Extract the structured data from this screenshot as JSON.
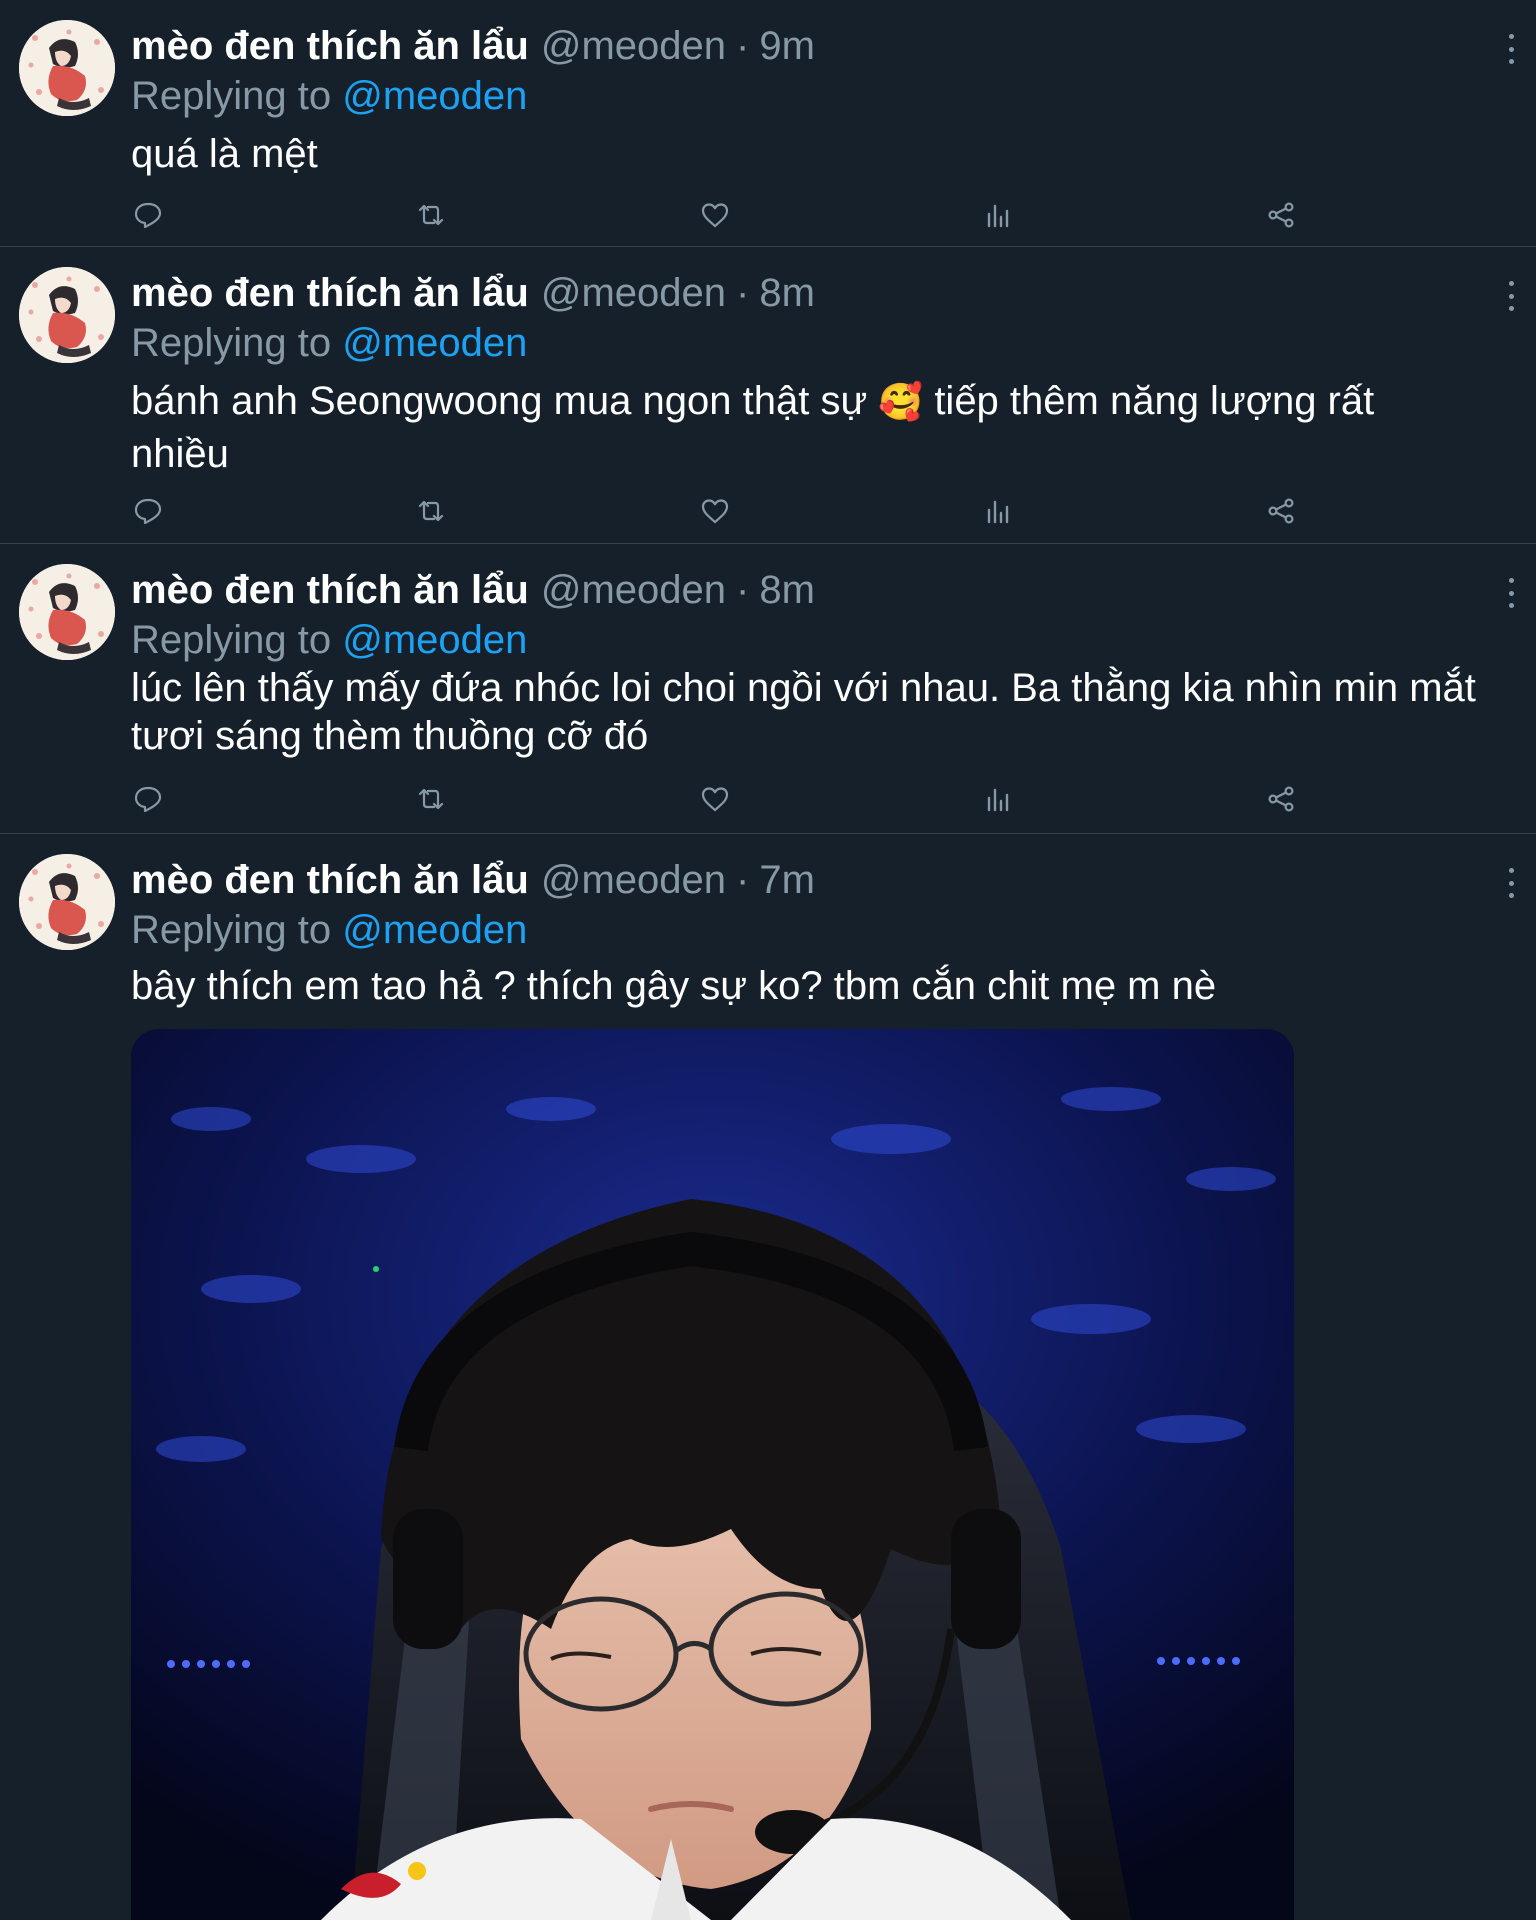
{
  "tweets": [
    {
      "author_name": "mèo đen thích ăn lẩu",
      "handle": "@meoden",
      "separator": "·",
      "time": "9m",
      "replying_prefix": "Replying to",
      "replying_handle": "@meoden",
      "text": "quá là mệt"
    },
    {
      "author_name": "mèo đen thích ăn lẩu",
      "handle": "@meoden",
      "separator": "·",
      "time": "8m",
      "replying_prefix": "Replying to",
      "replying_handle": "@meoden",
      "text_before_emoji": "bánh anh Seongwoong mua ngon thật sự",
      "emoji": "🥰",
      "text_after_emoji": "tiếp thêm năng lượng rất nhiều"
    },
    {
      "author_name": "mèo đen thích ăn lẩu",
      "handle": "@meoden",
      "separator": "·",
      "time": "8m",
      "replying_prefix": "Replying to",
      "replying_handle": "@meoden",
      "text": "lúc lên thấy mấy đứa nhóc loi choi ngồi với nhau. Ba thằng kia nhìn min mắt tươi sáng thèm thuồng cỡ đó"
    },
    {
      "author_name": "mèo đen thích ăn lẩu",
      "handle": "@meoden",
      "separator": "·",
      "time": "7m",
      "replying_prefix": "Replying to",
      "replying_handle": "@meoden",
      "text": "bây thích em tao hả ? thích gây sự ko? tbm cắn chit mẹ m nè"
    }
  ],
  "icons": {
    "reply": "reply-icon",
    "retweet": "retweet-icon",
    "like": "like-icon",
    "analytics": "analytics-icon",
    "share": "share-icon",
    "more": "more-icon"
  },
  "colors": {
    "background": "#15202b",
    "divider": "#38444d",
    "primary_text": "#ffffff",
    "secondary_text": "#8899a6",
    "mention": "#1da1f2"
  }
}
